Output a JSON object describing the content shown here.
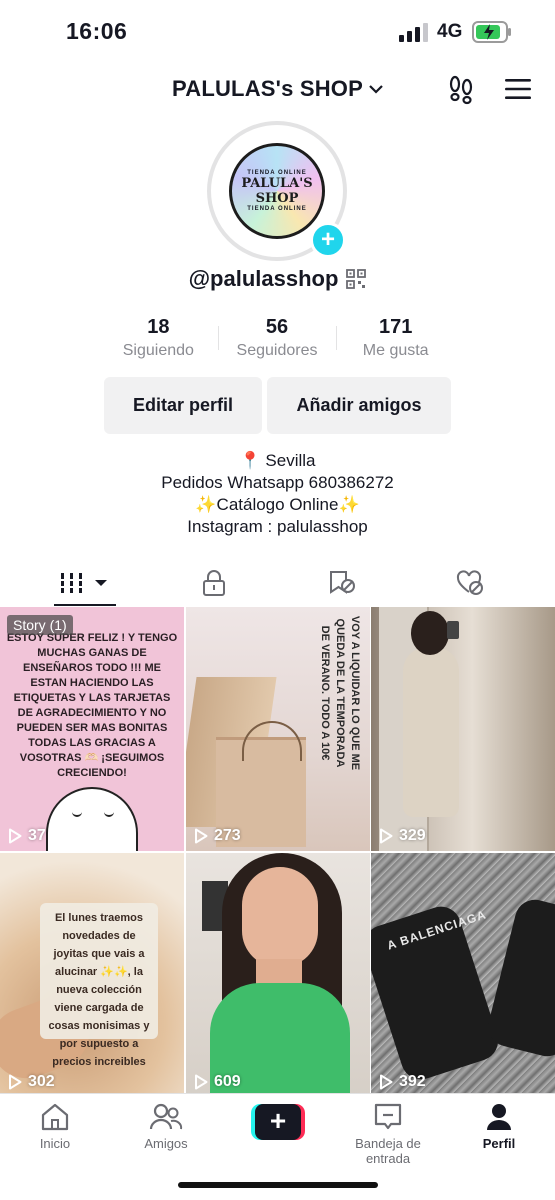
{
  "status_bar": {
    "time": "16:06",
    "network": "4G"
  },
  "header": {
    "title": "PALULAS's SHOP"
  },
  "avatar": {
    "arc_top": "TIENDA ONLINE",
    "logo": "PALULA'S SHOP",
    "arc_bottom": "TIENDA ONLINE"
  },
  "profile": {
    "username": "@palulasshop"
  },
  "stats": [
    {
      "value": "18",
      "label": "Siguiendo"
    },
    {
      "value": "56",
      "label": "Seguidores"
    },
    {
      "value": "171",
      "label": "Me gusta"
    }
  ],
  "buttons": {
    "edit": "Editar perfil",
    "add": "Añadir amigos"
  },
  "bio": {
    "line1": "📍 Sevilla",
    "line2": "Pedidos Whatsapp 680386272",
    "line3": "✨Catálogo Online✨",
    "line4": "Instagram : palulasshop"
  },
  "videos": [
    {
      "views": "37",
      "badge": "Story (1)",
      "text": "ESTOY SUPER FELIZ ! Y TENGO MUCHAS GANAS DE ENSEÑAROS TODO !!! ME ESTAN HACIENDO LAS ETIQUETAS Y LAS TARJETAS DE AGRADECIMIENTO Y NO PUEDEN SER MAS BONITAS TODAS LAS GRACIAS A VOSOTRAS 🫶🏻 ¡SEGUIMOS CRECIENDO!"
    },
    {
      "views": "273",
      "text": "VOY A LIQUIDAR LO QUE ME QUEDA DE LA TEMPORADA DE VERANO. TODO A 10€"
    },
    {
      "views": "329"
    },
    {
      "views": "302",
      "text": "El lunes traemos novedades de joyitas que vais a alucinar ✨✨, la nueva colección viene cargada de cosas monisimas y por supuesto a precios increibles"
    },
    {
      "views": "609"
    },
    {
      "views": "392",
      "text": "A BALENCIAGA"
    }
  ],
  "tabbar": {
    "home": "Inicio",
    "friends": "Amigos",
    "inbox": "Bandeja de entrada",
    "profile": "Perfil"
  }
}
